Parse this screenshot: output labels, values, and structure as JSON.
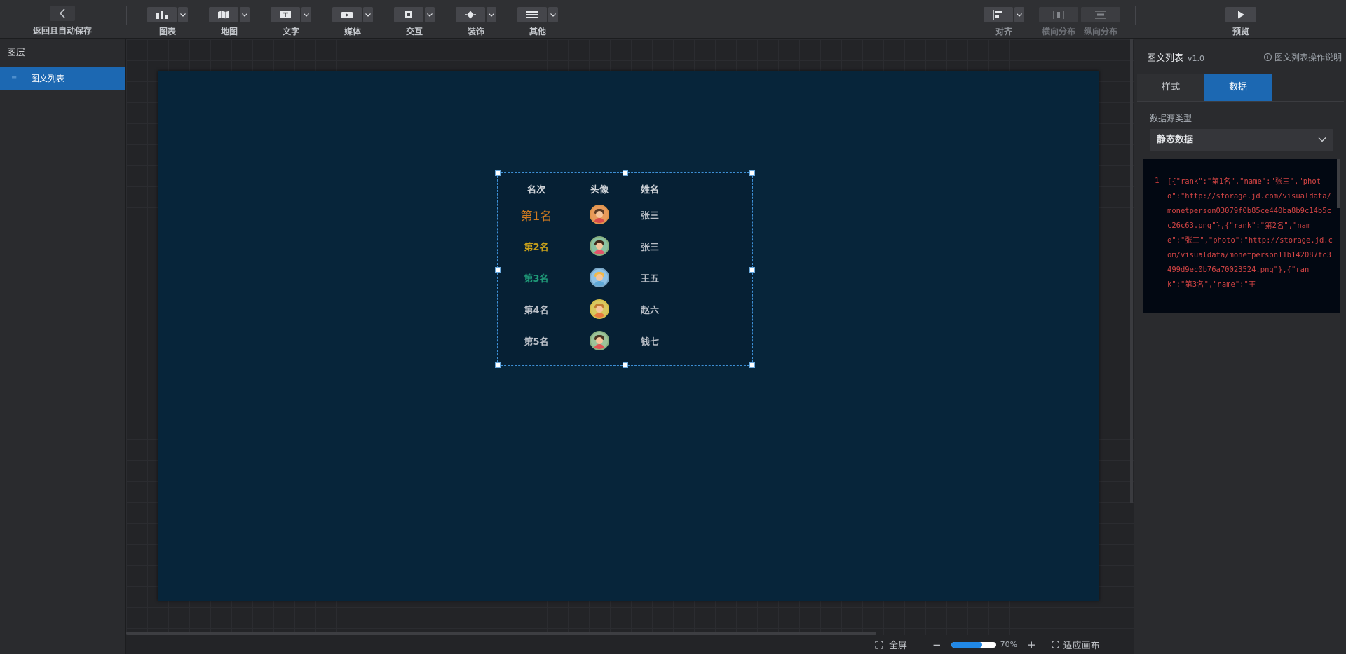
{
  "toolbar": {
    "back_label": "返回且自动保存",
    "groups": [
      {
        "label": "图表"
      },
      {
        "label": "地图"
      },
      {
        "label": "文字"
      },
      {
        "label": "媒体"
      },
      {
        "label": "交互"
      },
      {
        "label": "装饰"
      },
      {
        "label": "其他"
      }
    ],
    "align_label": "对齐",
    "hdist_label": "横向分布",
    "vdist_label": "纵向分布",
    "preview_label": "预览"
  },
  "layers": {
    "header": "图层",
    "items": [
      {
        "label": "图文列表"
      }
    ]
  },
  "widget": {
    "headers": {
      "rank": "名次",
      "photo": "头像",
      "name": "姓名"
    },
    "rows": [
      {
        "rank": "第1名",
        "name": "张三",
        "rank_color": "#d07a1f"
      },
      {
        "rank": "第2名",
        "name": "张三",
        "rank_color": "#c9a11a"
      },
      {
        "rank": "第3名",
        "name": "王五",
        "rank_color": "#1f9a78"
      },
      {
        "rank": "第4名",
        "name": "赵六",
        "rank_color": "#b9bec6"
      },
      {
        "rank": "第5名",
        "name": "钱七",
        "rank_color": "#b9bec6"
      }
    ]
  },
  "props": {
    "title": "图文列表",
    "version": "v1.0",
    "help": "图文列表操作说明",
    "tabs": [
      {
        "label": "样式"
      },
      {
        "label": "数据"
      }
    ],
    "active_tab": "数据",
    "ds_label": "数据源类型",
    "ds_value": "静态数据",
    "code_line": "1",
    "code": "[{\"rank\":\"第1名\",\"name\":\"张三\",\"photo\":\"http://storage.jd.com/visualdata/monetperson03079f0b85ce440ba8b9c14b5cc26c63.png\"},{\"rank\":\"第2名\",\"name\":\"张三\",\"photo\":\"http://storage.jd.com/visualdata/monetperson11b142087fc3499d9ec0b76a70023524.png\"},{\"rank\":\"第3名\",\"name\":\"王"
  },
  "status": {
    "fullscreen": "全屏",
    "zoom_out": "−",
    "zoom_in": "+",
    "zoom_value": "70%",
    "zoom_fraction": 0.7,
    "fit": "适应画布"
  },
  "colors": {
    "accent": "#1c68b2",
    "artboard": "#07253a",
    "code_text": "#d24444"
  }
}
